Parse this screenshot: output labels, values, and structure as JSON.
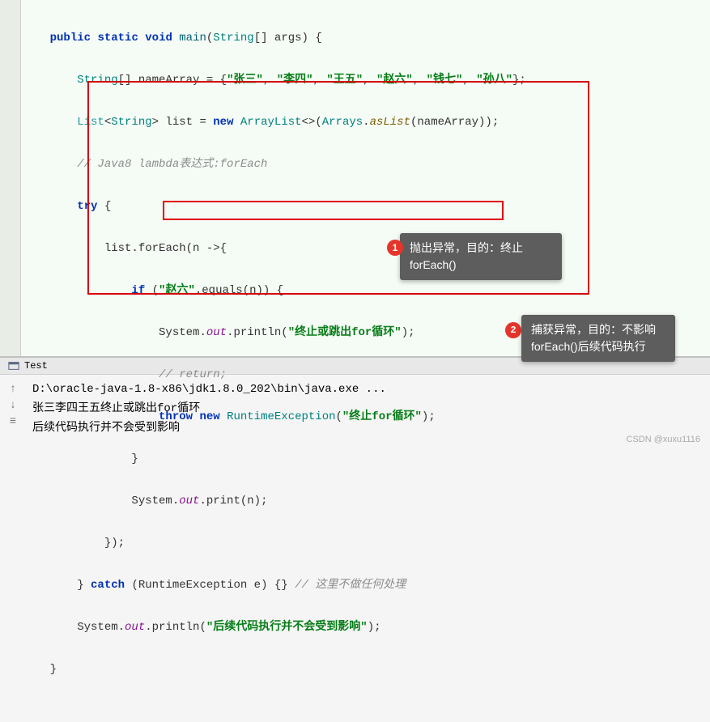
{
  "code": {
    "l1_public": "public",
    "l1_static": "static",
    "l1_void": "void",
    "l1_main": "main",
    "l1_string": "String",
    "l1_args": "[] args) {",
    "l2_string": "String",
    "l2_decl": "[] nameArray = {",
    "l2_s1": "\"张三\"",
    "l2_s2": "\"李四\"",
    "l2_s3": "\"王五\"",
    "l2_s4": "\"赵六\"",
    "l2_s5": "\"钱七\"",
    "l2_s6": "\"孙八\"",
    "l2_end": "};",
    "l3_list": "List",
    "l3_string": "String",
    "l3_var": "> list = ",
    "l3_new": "new",
    "l3_arraylist": "ArrayList",
    "l3_arrays": "Arrays",
    "l3_aslist": "asList",
    "l3_end": "(nameArray));",
    "l4_comment": "// Java8 lambda表达式:forEach",
    "l5_try": "try",
    "l5_brace": " {",
    "l6_foreach": "list.forEach(n ->{",
    "l7_if": "if",
    "l7_str": "\"赵六\"",
    "l7_equals": ".equals(n)) {",
    "l8_sys": "System.",
    "l8_out": "out",
    "l8_println": ".println(",
    "l8_str": "\"终止或跳出for循环\"",
    "l8_end": ");",
    "l9_comment": "// return;",
    "l10_throw": "throw",
    "l10_new": "new",
    "l10_exc": "RuntimeException",
    "l10_str": "\"终止for循环\"",
    "l10_end": ");",
    "l11_close": "}",
    "l12_sys": "System.",
    "l12_out": "out",
    "l12_print": ".print(n);",
    "l13_close": "});",
    "l14_catch": "} ",
    "l14_catchkw": "catch",
    "l14_exc": " (RuntimeException e) {} ",
    "l14_comment": "// 这里不做任何处理",
    "l15_sys": "System.",
    "l15_out": "out",
    "l15_println": ".println(",
    "l15_str": "\"后续代码执行并不会受到影响\"",
    "l15_end": ");",
    "l16_close": "}"
  },
  "callouts": {
    "c1_num": "1",
    "c1_text": "抛出异常，目的：终止forEach()",
    "c2_num": "2",
    "c2_text": "捕获异常，目的：不影响forEach()后续代码执行"
  },
  "panel": {
    "title": "Test",
    "run_cmd": "D:\\oracle-java-1.8-x86\\jdk1.8.0_202\\bin\\java.exe ...",
    "out1": "张三李四王五终止或跳出for循环",
    "out2": "后续代码执行并不会受到影响"
  },
  "watermark": "CSDN @xuxu1116"
}
